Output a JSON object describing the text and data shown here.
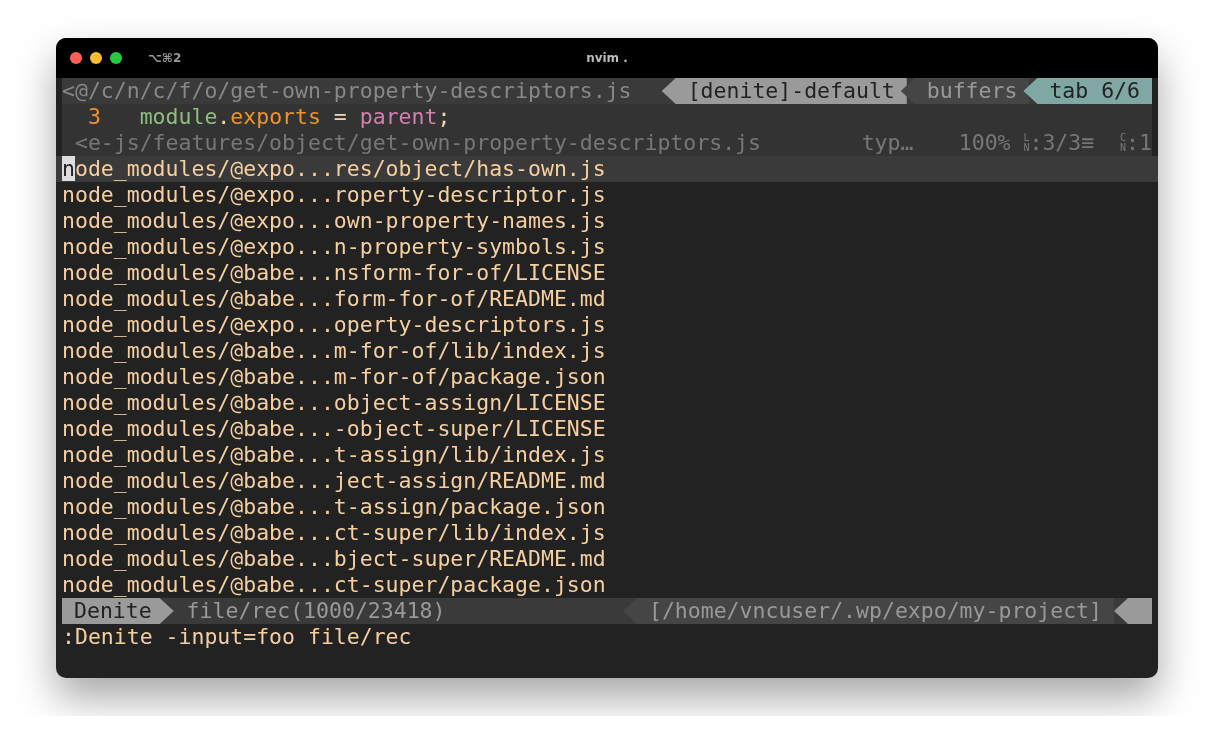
{
  "window": {
    "shortcut": "⌥⌘2",
    "title": "nvim ."
  },
  "tabline": {
    "path": "<@/c/n/c/f/o/get-own-property-descriptors.js",
    "segments": [
      {
        "label": "[denite]-default",
        "kind": "light"
      },
      {
        "label": "buffers",
        "kind": "dark"
      },
      {
        "label": "tab 6/6",
        "kind": "accent"
      }
    ]
  },
  "code_line": {
    "number": "3",
    "tokens": [
      {
        "text": "module",
        "kind": "identifier"
      },
      {
        "text": ".",
        "kind": "plain"
      },
      {
        "text": "exports",
        "kind": "property"
      },
      {
        "text": " = ",
        "kind": "plain"
      },
      {
        "text": "parent",
        "kind": "value"
      },
      {
        "text": ";",
        "kind": "plain"
      }
    ]
  },
  "statusline": {
    "path": "<e-js/features/object/get-own-property-descriptors.js",
    "filetype": "typ…",
    "percent": "100%",
    "line_icon": "LN",
    "line": ":3/3≡",
    "column_icon": "CN",
    "column": ":1"
  },
  "rows": [
    {
      "text": "node_modules/@expo...res/object/has-own.js",
      "selected": true,
      "cursor": true
    },
    {
      "text": "node_modules/@expo...roperty-descriptor.js",
      "selected": false,
      "cursor": false
    },
    {
      "text": "node_modules/@expo...own-property-names.js",
      "selected": false,
      "cursor": false
    },
    {
      "text": "node_modules/@expo...n-property-symbols.js",
      "selected": false,
      "cursor": false
    },
    {
      "text": "node_modules/@babe...nsform-for-of/LICENSE",
      "selected": false,
      "cursor": false
    },
    {
      "text": "node_modules/@babe...form-for-of/README.md",
      "selected": false,
      "cursor": false
    },
    {
      "text": "node_modules/@expo...operty-descriptors.js",
      "selected": false,
      "cursor": false
    },
    {
      "text": "node_modules/@babe...m-for-of/lib/index.js",
      "selected": false,
      "cursor": false
    },
    {
      "text": "node_modules/@babe...m-for-of/package.json",
      "selected": false,
      "cursor": false
    },
    {
      "text": "node_modules/@babe...object-assign/LICENSE",
      "selected": false,
      "cursor": false
    },
    {
      "text": "node_modules/@babe...-object-super/LICENSE",
      "selected": false,
      "cursor": false
    },
    {
      "text": "node_modules/@babe...t-assign/lib/index.js",
      "selected": false,
      "cursor": false
    },
    {
      "text": "node_modules/@babe...ject-assign/README.md",
      "selected": false,
      "cursor": false
    },
    {
      "text": "node_modules/@babe...t-assign/package.json",
      "selected": false,
      "cursor": false
    },
    {
      "text": "node_modules/@babe...ct-super/lib/index.js",
      "selected": false,
      "cursor": false
    },
    {
      "text": "node_modules/@babe...bject-super/README.md",
      "selected": false,
      "cursor": false
    },
    {
      "text": "node_modules/@babe...ct-super/package.json",
      "selected": false,
      "cursor": false
    }
  ],
  "denite_status": {
    "mode": "Denite",
    "source": "file/rec(1000/23418)",
    "cwd": "[/home/vncuser/.wp/expo/my-project]"
  },
  "command_line": ":Denite -input=foo file/rec"
}
